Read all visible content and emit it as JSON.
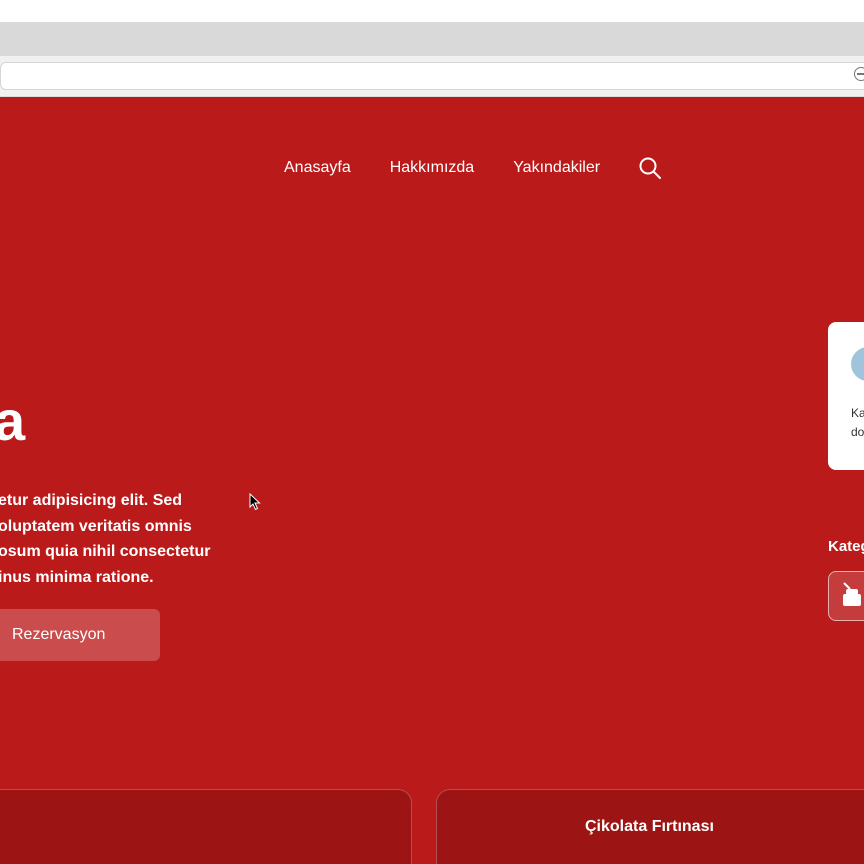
{
  "nav": {
    "items": [
      "Anasayfa",
      "Hakkımızda",
      "Yakındakiler"
    ]
  },
  "hero": {
    "title_fragment": "a",
    "lines": [
      "etur adipisicing elit. Sed",
      "oluptatem veritatis omnis",
      "osum quia nihil consectetur",
      "inus minima ratione."
    ],
    "cta_label": "Rezervasyon"
  },
  "side_card": {
    "line1": "Ka",
    "line2": "do"
  },
  "categories": {
    "label": "Kateg"
  },
  "cards": {
    "right_title": "Çikolata Fırtınası"
  },
  "colors": {
    "brand_red": "#bb1a1a",
    "card_red": "#9c1414"
  },
  "icons": [
    "search-icon",
    "zoom-icon",
    "cake-icon",
    "cursor-icon"
  ]
}
